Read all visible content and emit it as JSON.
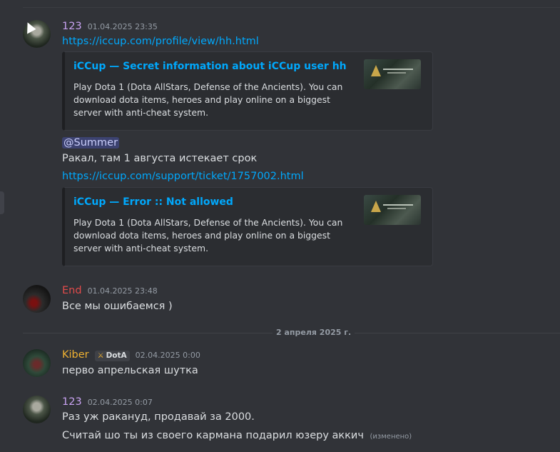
{
  "colors": {
    "user_123": "#c9a3f2",
    "user_end": "#e24b4b",
    "user_kiber": "#f0b232",
    "link": "#00a8fc"
  },
  "messages": [
    {
      "username": "123",
      "timestamp": "01.04.2025 23:35",
      "link1": "https://iccup.com/profile/view/hh.html",
      "embed1": {
        "title": "iCCup — Secret information about iCCup user hh",
        "description": "Play Dota 1 (Dota AllStars, Defense of the Ancients). You can download dota items, heroes and play online on a biggest server with anti-cheat system."
      },
      "mention": "@Summer",
      "text1": "Ракал, там 1 августа истекает срок",
      "link2": "https://iccup.com/support/ticket/1757002.html",
      "embed2": {
        "title": "iCCup — Error :: Not allowed",
        "description": "Play Dota 1 (Dota AllStars, Defense of the Ancients). You can download dota items, heroes and play online on a biggest server with anti-cheat system."
      }
    },
    {
      "username": "End",
      "timestamp": "01.04.2025 23:48",
      "text": "Все мы ошибаемся )"
    },
    {
      "username": "Kiber",
      "badge": "DotA",
      "timestamp": "02.04.2025 0:00",
      "text": "перво апрельская шутка"
    },
    {
      "username": "123",
      "timestamp": "02.04.2025 0:07",
      "text1": "Раз уж ракануд, продавай за 2000.",
      "text2": "Считай шо ты из своего кармана подарил юзеру аккич",
      "edited": "(изменено)"
    }
  ],
  "date_divider": "2 апреля 2025 г."
}
